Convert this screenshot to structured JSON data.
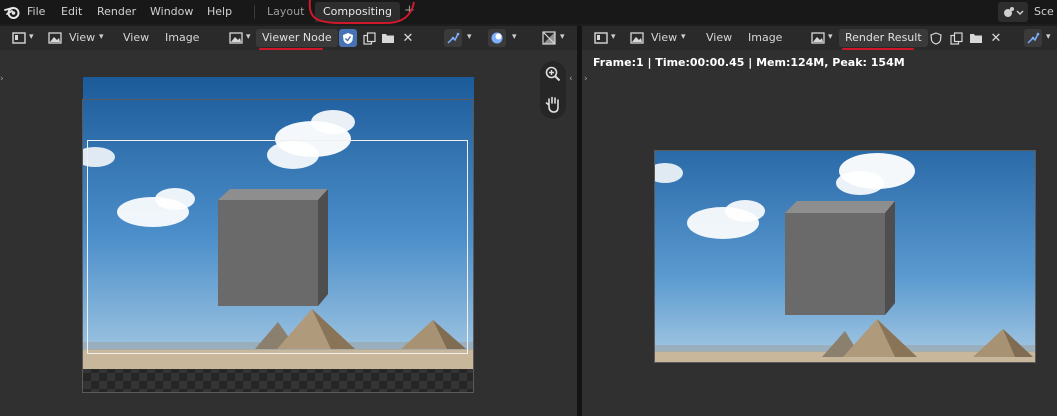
{
  "menu": [
    "File",
    "Edit",
    "Render",
    "Window",
    "Help"
  ],
  "workspaces": {
    "layout": "Layout",
    "compositing": "Compositing",
    "add": "+"
  },
  "scene_label": "Sce",
  "left_editor": {
    "view_dropdown": "View",
    "view_menu": "View",
    "image_menu": "Image",
    "image_name": "Viewer Node"
  },
  "right_editor": {
    "view_dropdown": "View",
    "view_menu": "View",
    "image_menu": "Image",
    "image_name": "Render Result",
    "render_info": "Frame:1 | Time:00:00.45 | Mem:124M, Peak: 154M"
  },
  "colors": {
    "annotation_red": "#d0182a",
    "accent_blue": "#4772b3",
    "sky_top": "#1c5b9a",
    "sky_bottom": "#a9cbe4"
  }
}
